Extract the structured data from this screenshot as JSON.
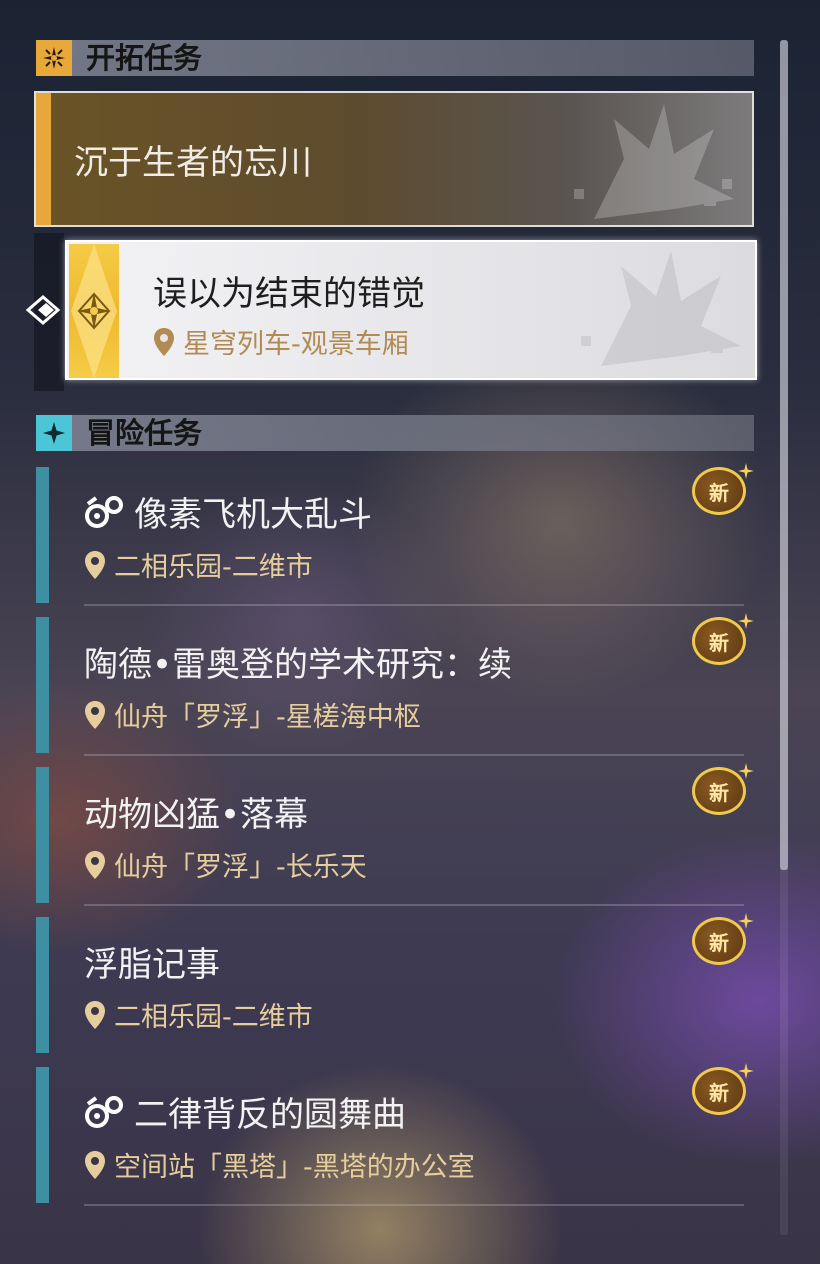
{
  "trailblaze_section": {
    "title": "开拓任务",
    "icon": "compass-star-icon",
    "accent": "#e8a93a"
  },
  "main_quest": {
    "title": "沉于生者的忘川",
    "emblem": "dragon-emblem-icon"
  },
  "active_subquest": {
    "title": "误以为结束的错觉",
    "location": "星穹列车-观景车厢",
    "marker": "track-pointer-icon"
  },
  "adventure_section": {
    "title": "冒险任务",
    "icon": "four-point-star-icon",
    "accent": "#4cc5d6"
  },
  "quests": [
    {
      "title": "像素飞机大乱斗",
      "location": "二相乐园-二维市",
      "badge": "新",
      "has_activity_icon": true
    },
    {
      "title": "陶德•雷奥登的学术研究：续",
      "location": "仙舟「罗浮」-星槎海中枢",
      "badge": "新",
      "has_activity_icon": false
    },
    {
      "title": "动物凶猛•落幕",
      "location": "仙舟「罗浮」-长乐天",
      "badge": "新",
      "has_activity_icon": false
    },
    {
      "title": "浮脂记事",
      "location": "二相乐园-二维市",
      "badge": "新",
      "has_activity_icon": false
    },
    {
      "title": "二律背反的圆舞曲",
      "location": "空间站「黑塔」-黑塔的办公室",
      "badge": "新",
      "has_activity_icon": true
    }
  ]
}
